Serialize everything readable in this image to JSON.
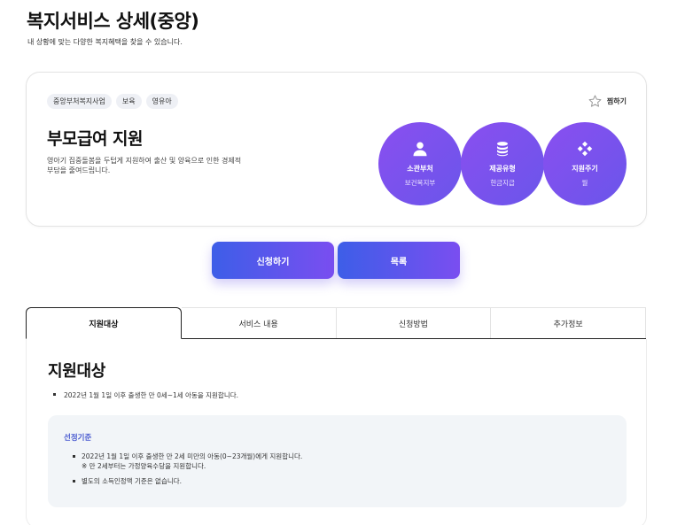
{
  "header": {
    "title": "복지서비스 상세(중앙)",
    "subtitle": "내 상황에 맞는 다양한 복지혜택을 찾을 수 있습니다."
  },
  "card": {
    "tags": [
      "중앙부처복지사업",
      "보육",
      "영유아"
    ],
    "favorite_label": "찜하기",
    "service_name": "부모급여 지원",
    "description": "영아기 집중돌봄을 두텁게 지원하여 출산 및 양육으로 인한 경제적 부담을 줄여드립니다.",
    "info": [
      {
        "icon": "person-icon",
        "title": "소관부처",
        "value": "보건복지부"
      },
      {
        "icon": "database-icon",
        "title": "제공유형",
        "value": "현금지급"
      },
      {
        "icon": "cycle-icon",
        "title": "지원주기",
        "value": "월"
      }
    ]
  },
  "actions": {
    "apply_label": "신청하기",
    "list_label": "목록"
  },
  "tabs": [
    {
      "label": "지원대상",
      "active": true
    },
    {
      "label": "서비스 내용",
      "active": false
    },
    {
      "label": "신청방법",
      "active": false
    },
    {
      "label": "추가정보",
      "active": false
    }
  ],
  "content": {
    "section_title": "지원대상",
    "target_items": [
      "2022년 1월 1일 이후 출생한 만 0세~1세 아동을 지원합니다."
    ],
    "criteria": {
      "title": "선정기준",
      "item1": "2022년 1월 1일 이후 출생한 만 2세 미만의 아동(0~23개월)에게 지원합니다.",
      "item1_note": "※ 만 2세부터는 가정양육수당을 지원합니다.",
      "item2": "별도의 소득인정액 기준은 없습니다."
    }
  },
  "colors": {
    "accent_purple": "#7a4ef0",
    "accent_blue": "#3d5ee8",
    "criteria_title": "#4a5bd0"
  }
}
